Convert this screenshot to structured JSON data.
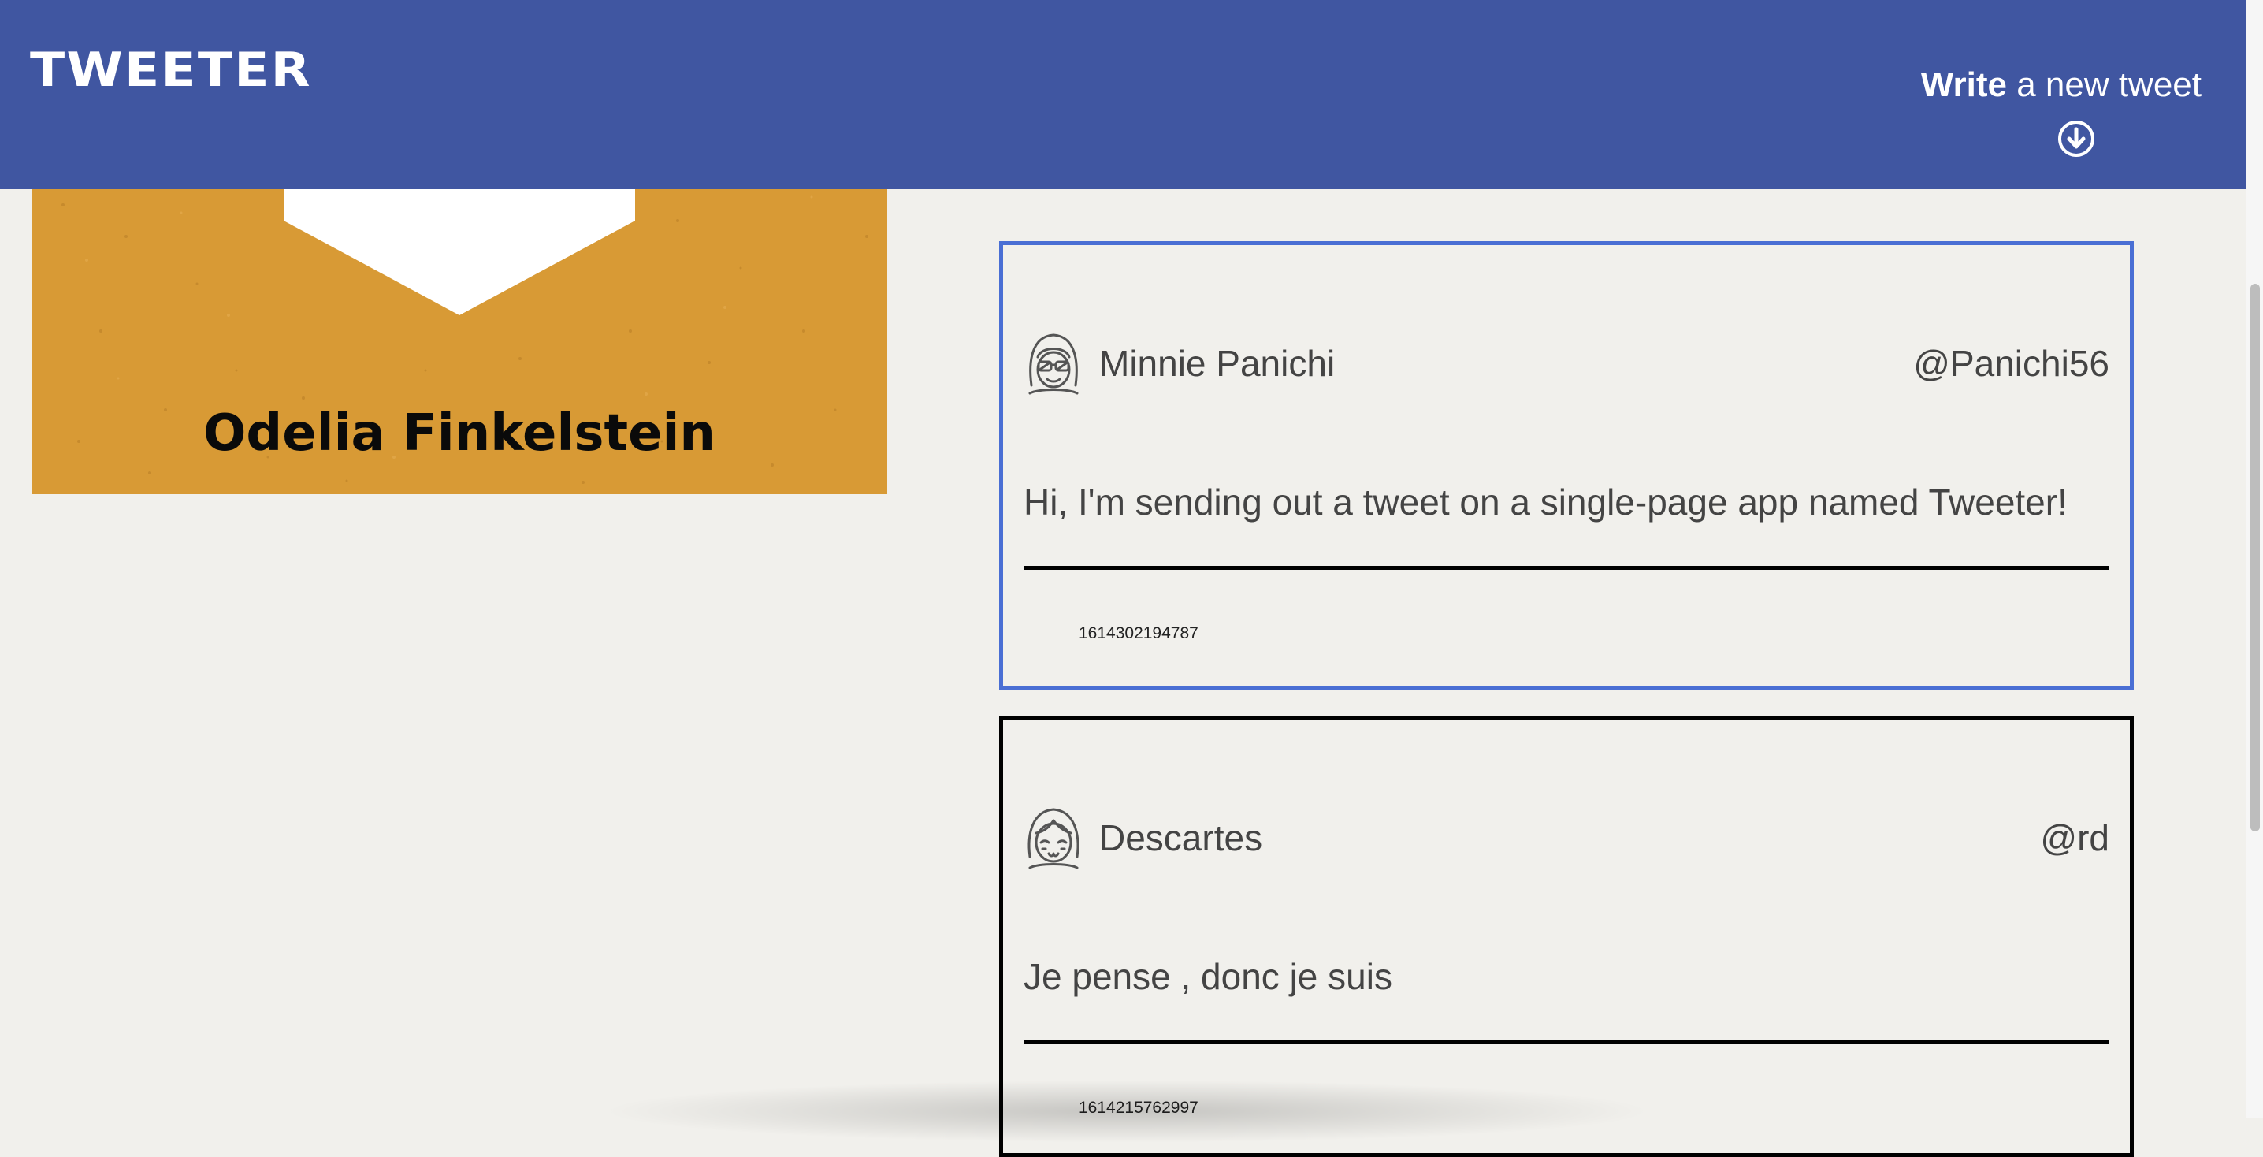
{
  "nav": {
    "brand": "TWEETER",
    "compose_bold": "Write",
    "compose_rest": " a new tweet",
    "compose_icon": "arrow-down-circle-icon"
  },
  "profile": {
    "name": "Odelia Finkelstein",
    "background_color": "#d89a35",
    "avatar_icon": "profile-avatar-icon"
  },
  "tweets": [
    {
      "name": "Minnie Panichi",
      "handle": "@Panichi56",
      "text": "Hi, I'm sending out a tweet on a single-page app named Tweeter!",
      "timestamp": "1614302194787",
      "avatar_icon": "sunglasses-avatar-icon",
      "state": "hovered"
    },
    {
      "name": "Descartes",
      "handle": "@rd",
      "text": "Je pense , donc je suis",
      "timestamp": "1614215762997",
      "avatar_icon": "smiling-avatar-icon",
      "state": "default"
    }
  ],
  "colors": {
    "nav": "#4056a1",
    "page_background": "#f1f0ec",
    "active_border": "#4a6fd4",
    "tweet_border": "#000000"
  }
}
